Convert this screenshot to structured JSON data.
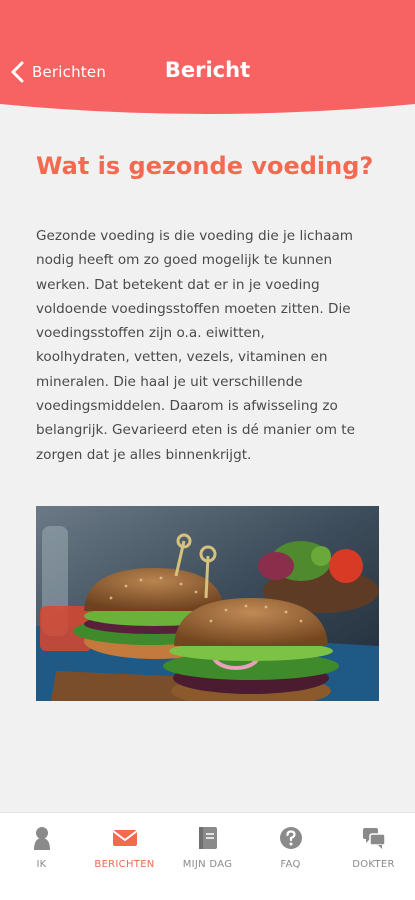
{
  "colors": {
    "header": "#f76363",
    "accent": "#f26a50",
    "background": "#f1f1f1",
    "text": "#4a4a4a",
    "nav_inactive": "#8a8a8a"
  },
  "header": {
    "back_label": "Berichten",
    "back_icon": "chevron-left-icon",
    "title": "Bericht"
  },
  "article": {
    "title": "Wat is gezonde voeding?",
    "body_lines": [
      "Gezonde voeding is die voeding die je lichaam",
      "nodig heeft om zo goed mogelijk te kunnen",
      "werken. Dat betekent dat er in je voeding",
      "voldoende voedingsstoffen moeten zitten. Die",
      "voedingsstoffen zijn o.a. eiwitten,",
      "koolhydraten, vetten, vezels, vitaminen en",
      "mineralen. Die haal je uit verschillende",
      "voedingsmiddelen. Daarom is afwisseling zo",
      "belangrijk. Gevarieerd eten is dé manier om te",
      "zorgen dat je alles binnenkrijgt."
    ],
    "image": "veggie-burger-photo"
  },
  "nav": {
    "active": "berichten",
    "items": [
      {
        "key": "ik",
        "label": "IK",
        "icon": "person-icon"
      },
      {
        "key": "berichten",
        "label": "BERICHTEN",
        "icon": "envelope-icon"
      },
      {
        "key": "mijn-dag",
        "label": "MIJN DAG",
        "icon": "journal-icon"
      },
      {
        "key": "faq",
        "label": "FAQ",
        "icon": "question-icon"
      },
      {
        "key": "dokter",
        "label": "DOKTER",
        "icon": "chat-icon"
      }
    ]
  }
}
